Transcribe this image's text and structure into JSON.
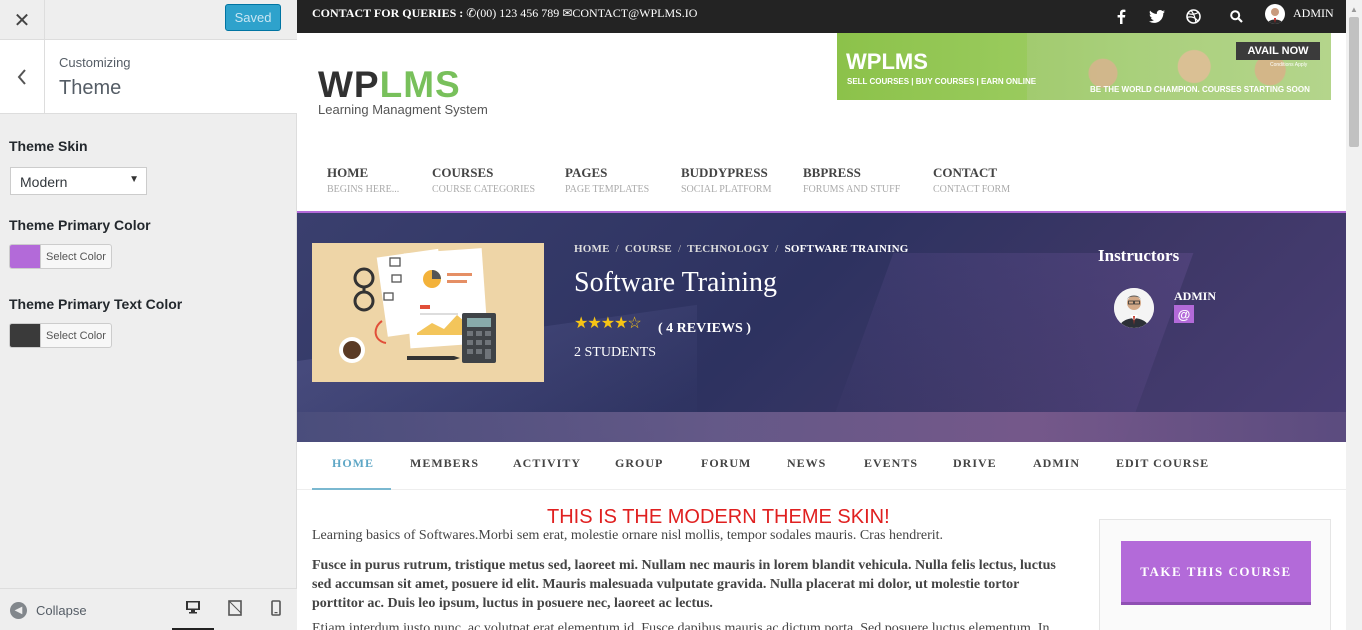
{
  "customizer": {
    "close_icon": "close-icon",
    "saved_label": "Saved",
    "breadcrumb": "Customizing",
    "section_title": "Theme",
    "theme_skin_label": "Theme Skin",
    "theme_skin_value": "Modern",
    "primary_color_label": "Theme Primary Color",
    "primary_color": "#b36ad9",
    "primary_color_button": "Select Color",
    "primary_text_color_label": "Theme Primary Text Color",
    "primary_text_color": "#3a3a3a",
    "primary_text_color_button": "Select Color",
    "collapse_label": "Collapse",
    "devices": [
      "desktop-icon",
      "tablet-icon",
      "mobile-icon"
    ]
  },
  "preview": {
    "topbar": {
      "contact_label": "CONTACT FOR QUERIES :",
      "phone": "(00) 123 456 789",
      "email": "CONTACT@WPLMS.IO",
      "social_icons": [
        "facebook-icon",
        "twitter-icon",
        "dribbble-icon",
        "search-icon"
      ],
      "user_name": "ADMIN"
    },
    "logo": {
      "part1": "WP",
      "part2": "LMS",
      "tagline": "Learning Managment System"
    },
    "banner": {
      "brand": "WPLMS",
      "tagline": "SELL COURSES | BUY COURSES | EARN ONLINE",
      "cta": "AVAIL NOW",
      "conditions": "Conditions Apply",
      "slogan": "BE THE WORLD CHAMPION. COURSES STARTING SOON"
    },
    "nav": [
      {
        "title": "HOME",
        "subtitle": "BEGINS HERE..."
      },
      {
        "title": "COURSES",
        "subtitle": "COURSE CATEGORIES"
      },
      {
        "title": "PAGES",
        "subtitle": "PAGE TEMPLATES"
      },
      {
        "title": "BUDDYPRESS",
        "subtitle": "SOCIAL PLATFORM"
      },
      {
        "title": "BBPRESS",
        "subtitle": "FORUMS AND STUFF"
      },
      {
        "title": "CONTACT",
        "subtitle": "CONTACT FORM"
      }
    ],
    "course": {
      "breadcrumbs": [
        "HOME",
        "COURSE",
        "TECHNOLOGY",
        "SOFTWARE TRAINING"
      ],
      "title": "Software Training",
      "rating_stars": 4,
      "rating_max": 5,
      "reviews": "( 4 REVIEWS )",
      "students": "2 STUDENTS",
      "instructors_label": "Instructors",
      "instructor_name": "ADMIN",
      "instructor_badge": "@"
    },
    "tabs": [
      "HOME",
      "MEMBERS",
      "ACTIVITY",
      "GROUP",
      "FORUM",
      "NEWS",
      "EVENTS",
      "DRIVE",
      "ADMIN",
      "EDIT COURSE"
    ],
    "active_tab": "HOME",
    "content": {
      "skin_message": "THIS IS THE MODERN THEME SKIN!",
      "paragraph1": "Learning basics of Softwares.Morbi sem erat, molestie ornare nisl mollis, tempor sodales mauris. Cras hendrerit.",
      "paragraph2": "Fusce in purus rutrum, tristique metus sed, laoreet mi. Nullam nec mauris in lorem blandit vehicula. Nulla felis lectus, luctus sed accumsan sit amet, posuere id elit. Mauris malesuada vulputate gravida. Nulla placerat mi dolor, ut molestie tortor porttitor ac. Duis leo ipsum, luctus in posuere nec, laoreet ac lectus.",
      "paragraph3": "Etiam interdum justo nunc, ac volutpat erat elementum id. Fusce dapibus mauris ac dictum porta. Sed posuere luctus elementum. In",
      "take_course_button": "TAKE THIS COURSE"
    }
  }
}
